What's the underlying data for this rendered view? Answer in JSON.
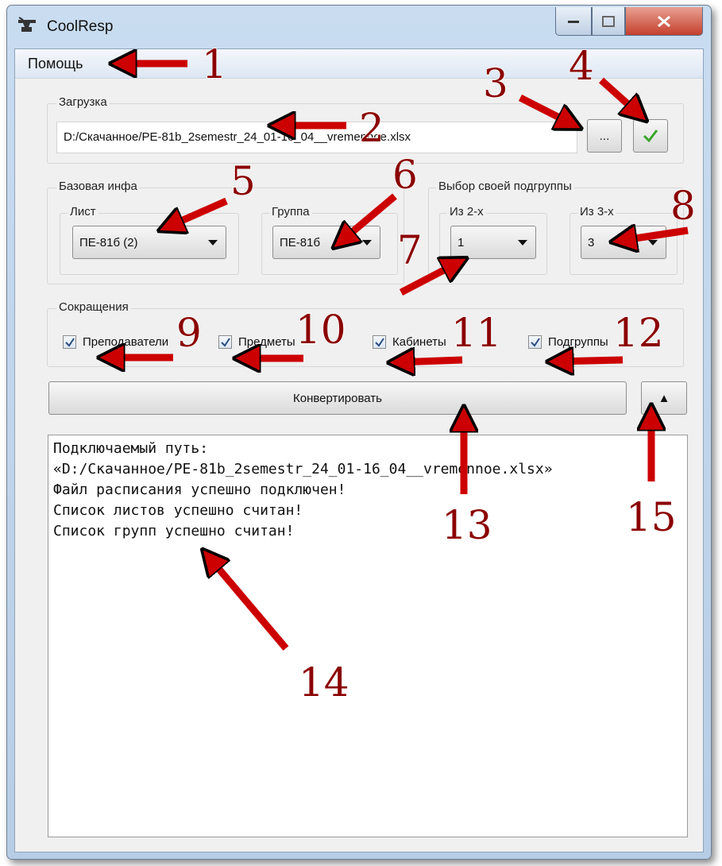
{
  "window": {
    "title": "CoolResp"
  },
  "menu": {
    "help": "Помощь"
  },
  "load": {
    "legend": "Загрузка",
    "path": "D:/Скачанное/PE-81b_2semestr_24_01-16_04__vremennoe.xlsx",
    "browse_label": "...",
    "confirm_icon": "checkmark-icon"
  },
  "base": {
    "legend": "Базовая инфа",
    "sheet": {
      "label": "Лист",
      "value": "ПЕ-81б (2)"
    },
    "group": {
      "label": "Группа",
      "value": "ПЕ-81б"
    }
  },
  "subgroup": {
    "legend": "Выбор своей подгруппы",
    "of2": {
      "label": "Из 2-х",
      "value": "1"
    },
    "of3": {
      "label": "Из 3-х",
      "value": "3"
    }
  },
  "abbr": {
    "legend": "Сокращения",
    "items": [
      {
        "label": "Преподаватели",
        "checked": true
      },
      {
        "label": "Предметы",
        "checked": true
      },
      {
        "label": "Кабинеты",
        "checked": true
      },
      {
        "label": "Подгруппы",
        "checked": true
      }
    ]
  },
  "actions": {
    "convert": "Конвертировать",
    "toggle": "▲"
  },
  "log": {
    "lines": [
      "Подключаемый путь:",
      "«D:/Скачанное/PE-81b_2semestr_24_01-16_04__vremennoe.xlsx»",
      "Файл расписания успешно подключен!",
      "Список листов успешно считан!",
      "Список групп успешно считан!"
    ]
  },
  "annotations": [
    "1",
    "2",
    "3",
    "4",
    "5",
    "6",
    "7",
    "8",
    "9",
    "10",
    "11",
    "12",
    "13",
    "14",
    "15"
  ],
  "colors": {
    "arrow_fill": "#cc0000",
    "number_color": "#8b0000",
    "check_green": "#3aa62b"
  }
}
